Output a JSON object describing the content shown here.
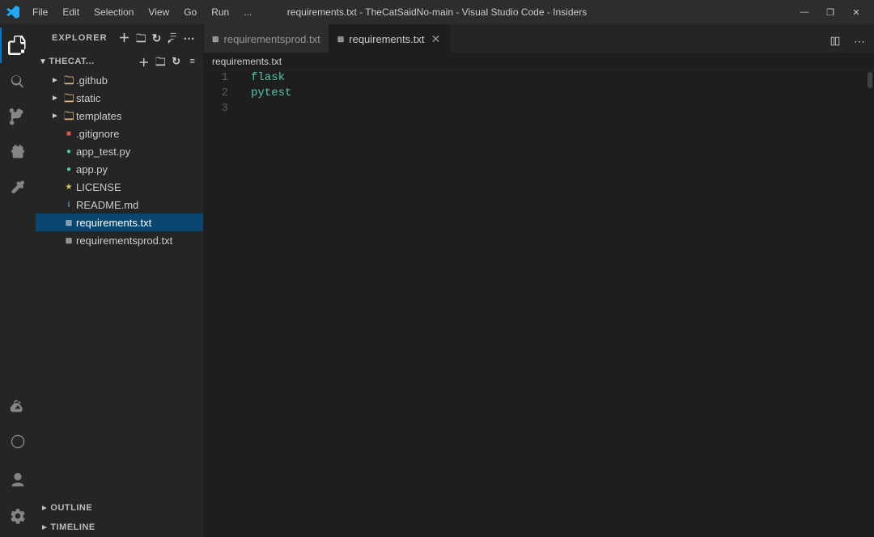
{
  "titleBar": {
    "title": "requirements.txt - TheCatSaidNo-main - Visual Studio Code - Insiders",
    "menuItems": [
      "File",
      "Edit",
      "Selection",
      "View",
      "Go",
      "Run"
    ],
    "moreMenu": "...",
    "windowButtons": [
      "minimize",
      "maximize",
      "restore",
      "close"
    ]
  },
  "activityBar": {
    "items": [
      {
        "name": "explorer",
        "label": "Explorer",
        "active": true
      },
      {
        "name": "search",
        "label": "Search"
      },
      {
        "name": "source-control",
        "label": "Source Control"
      },
      {
        "name": "run-debug",
        "label": "Run and Debug"
      },
      {
        "name": "extensions",
        "label": "Extensions"
      },
      {
        "name": "test",
        "label": "Testing"
      },
      {
        "name": "remote",
        "label": "Remote Explorer"
      }
    ],
    "bottomItems": [
      {
        "name": "account",
        "label": "Account"
      },
      {
        "name": "settings",
        "label": "Settings"
      }
    ]
  },
  "sidebar": {
    "header": "Explorer",
    "headerIcons": [
      "new-file",
      "new-folder",
      "refresh",
      "collapse-all",
      "more"
    ],
    "folder": {
      "name": "THECAT...",
      "expanded": true
    },
    "treeItems": [
      {
        "type": "folder",
        "name": ".github",
        "indent": 1,
        "collapsed": true
      },
      {
        "type": "folder",
        "name": "static",
        "indent": 1,
        "collapsed": true
      },
      {
        "type": "folder",
        "name": "templates",
        "indent": 1,
        "collapsed": true
      },
      {
        "type": "file",
        "name": ".gitignore",
        "indent": 1,
        "fileType": "gitignore"
      },
      {
        "type": "file",
        "name": "app_test.py",
        "indent": 1,
        "fileType": "py"
      },
      {
        "type": "file",
        "name": "app.py",
        "indent": 1,
        "fileType": "py"
      },
      {
        "type": "file",
        "name": "LICENSE",
        "indent": 1,
        "fileType": "license"
      },
      {
        "type": "file",
        "name": "README.md",
        "indent": 1,
        "fileType": "md"
      },
      {
        "type": "file",
        "name": "requirements.txt",
        "indent": 1,
        "fileType": "txt",
        "selected": true
      },
      {
        "type": "file",
        "name": "requirementsprod.txt",
        "indent": 1,
        "fileType": "txt"
      }
    ],
    "outline": "OUTLINE",
    "timeline": "TIMELINE"
  },
  "tabs": [
    {
      "name": "requirementsprod.txt",
      "active": false,
      "dirty": false,
      "icon": "txt"
    },
    {
      "name": "requirements.txt",
      "active": true,
      "dirty": false,
      "icon": "txt"
    }
  ],
  "breadcrumb": {
    "items": [
      "requirements.txt"
    ]
  },
  "editor": {
    "lines": [
      {
        "number": 1,
        "content": "flask",
        "tokens": [
          {
            "text": "flask",
            "class": "code-flask"
          }
        ]
      },
      {
        "number": 2,
        "content": "pytest",
        "tokens": [
          {
            "text": "pytest",
            "class": "code-pytest"
          }
        ]
      },
      {
        "number": 3,
        "content": "",
        "tokens": []
      }
    ]
  }
}
